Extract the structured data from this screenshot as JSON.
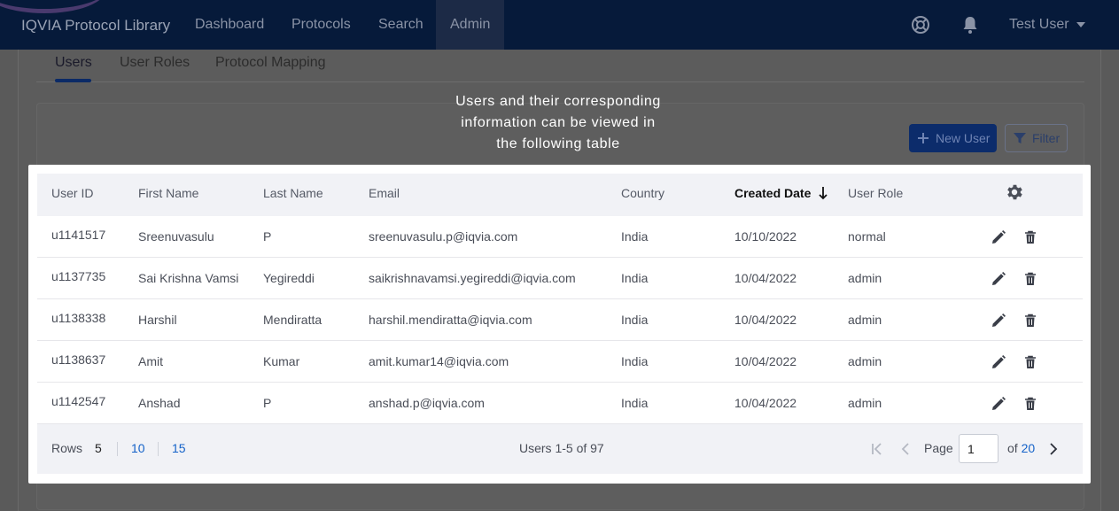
{
  "app": {
    "title": "IQVIA Protocol Library",
    "nav": [
      {
        "label": "Dashboard",
        "active": false
      },
      {
        "label": "Protocols",
        "active": false
      },
      {
        "label": "Search",
        "active": false
      },
      {
        "label": "Admin",
        "active": true
      }
    ],
    "icons": [
      "help-circle-icon",
      "bell-icon"
    ],
    "user": "Test User"
  },
  "tabs": [
    {
      "label": "Users",
      "active": true
    },
    {
      "label": "User Roles",
      "active": false
    },
    {
      "label": "Protocol Mapping",
      "active": false
    }
  ],
  "tooltip": {
    "lines": [
      "Users and their corresponding",
      "information can be viewed in",
      "the following table"
    ]
  },
  "actions": {
    "new_user": "New User",
    "filter": "Filter"
  },
  "table": {
    "columns": [
      "User ID",
      "First Name",
      "Last Name",
      "Email",
      "Country",
      "Created Date",
      "User Role"
    ],
    "sorted_column": "Created Date",
    "sort_direction": "descending",
    "rows": [
      {
        "user_id": "u1141517",
        "first_name": "Sreenuvasulu",
        "last_name": "P",
        "email": "sreenuvasulu.p@iqvia.com",
        "country": "India",
        "created": "10/10/2022",
        "role": "normal"
      },
      {
        "user_id": "u1137735",
        "first_name": "Sai Krishna Vamsi",
        "last_name": "Yegireddi",
        "email": "saikrishnavamsi.yegireddi@iqvia.com",
        "country": "India",
        "created": "10/04/2022",
        "role": "admin"
      },
      {
        "user_id": "u1138338",
        "first_name": "Harshil",
        "last_name": "Mendiratta",
        "email": "harshil.mendiratta@iqvia.com",
        "country": "India",
        "created": "10/04/2022",
        "role": "admin"
      },
      {
        "user_id": "u1138637",
        "first_name": "Amit",
        "last_name": "Kumar",
        "email": "amit.kumar14@iqvia.com",
        "country": "India",
        "created": "10/04/2022",
        "role": "admin"
      },
      {
        "user_id": "u1142547",
        "first_name": "Anshad",
        "last_name": "P",
        "email": "anshad.p@iqvia.com",
        "country": "India",
        "created": "10/04/2022",
        "role": "admin"
      }
    ]
  },
  "footer": {
    "rows_label": "Rows",
    "row_options": [
      "5",
      "10",
      "15"
    ],
    "selected_rows": "5",
    "summary": "Users 1-5 of 97",
    "page_label": "Page",
    "page_value": "1",
    "of_label": "of",
    "total_pages": "20"
  },
  "colors": {
    "navbar": "#061a3a",
    "primary": "#0c2c6b",
    "link": "#1462c8"
  }
}
